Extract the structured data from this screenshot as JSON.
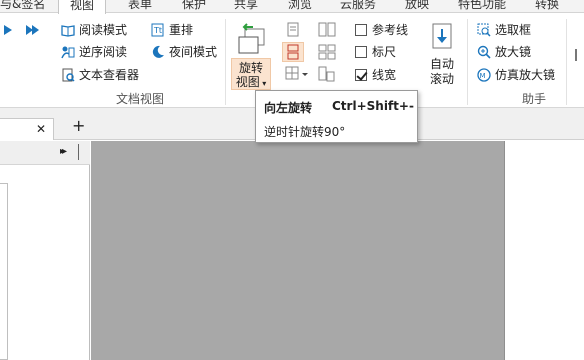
{
  "tabs": [
    {
      "label": "与&签名"
    },
    {
      "label": "视图",
      "active": true
    },
    {
      "label": "表单"
    },
    {
      "label": "保护"
    },
    {
      "label": "共享"
    },
    {
      "label": "浏览"
    },
    {
      "label": "云服务"
    },
    {
      "label": "放映"
    },
    {
      "label": "特色功能"
    },
    {
      "label": "转换"
    }
  ],
  "ribbon": {
    "doc_view": {
      "read_mode": "阅读模式",
      "reverse_read": "逆序阅读",
      "text_viewer": "文本查看器",
      "reflow": "重排",
      "night_mode": "夜间模式",
      "group_label": "文档视图"
    },
    "rotate": {
      "line1": "旋转",
      "line2": "视图"
    },
    "lines": {
      "guides": "参考线",
      "ruler": "标尺",
      "linewidth": "线宽",
      "guides_checked": false,
      "ruler_checked": false,
      "linewidth_checked": true
    },
    "autoscroll": {
      "line1": "自动",
      "line2": "滚动"
    },
    "assistant": {
      "select_box": "选取框",
      "magnifier": "放大镜",
      "loupe": "仿真放大镜",
      "group_label": "助手"
    }
  },
  "tooltip": {
    "title": "向左旋转",
    "shortcut": "Ctrl+Shift+-",
    "desc": "逆时针旋转90°"
  },
  "doc_tabs": {
    "close_glyph": "✕",
    "add_glyph": "+"
  },
  "panel": {
    "expand_glyph": "▸▸"
  },
  "colors": {
    "accent": "#1b75bc",
    "rotate_highlight": "#fbe3cf",
    "canvas": "#a8a8a8"
  }
}
